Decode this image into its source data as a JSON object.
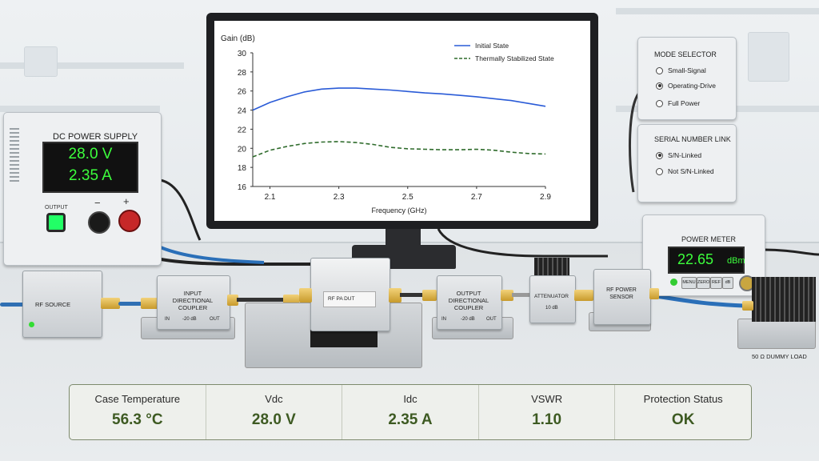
{
  "chart": {
    "ylabel": "Gain (dB)",
    "xlabel": "Frequency (GHz)",
    "y_ticks": [
      "30",
      "28",
      "26",
      "24",
      "22",
      "20",
      "18",
      "16"
    ],
    "x_ticks": [
      "2.1",
      "2.3",
      "2.5",
      "2.7",
      "2.9"
    ],
    "legend": [
      "Initial State",
      "Thermally Stabilized State"
    ]
  },
  "chart_data": {
    "type": "line",
    "xlabel": "Frequency (GHz)",
    "ylabel": "Gain (dB)",
    "xlim": [
      2.05,
      2.9
    ],
    "ylim": [
      16,
      30
    ],
    "series": [
      {
        "name": "Initial State",
        "color": "#2a5bd7",
        "style": "solid",
        "x": [
          2.05,
          2.1,
          2.15,
          2.2,
          2.25,
          2.3,
          2.35,
          2.4,
          2.45,
          2.5,
          2.55,
          2.6,
          2.65,
          2.7,
          2.75,
          2.8,
          2.85,
          2.9
        ],
        "y": [
          24.0,
          24.8,
          25.4,
          25.9,
          26.2,
          26.3,
          26.3,
          26.2,
          26.1,
          25.95,
          25.8,
          25.7,
          25.55,
          25.4,
          25.2,
          25.0,
          24.7,
          24.4
        ]
      },
      {
        "name": "Thermally Stabilized State",
        "color": "#2e6b2b",
        "style": "dashed",
        "x": [
          2.05,
          2.1,
          2.15,
          2.2,
          2.25,
          2.3,
          2.35,
          2.4,
          2.45,
          2.5,
          2.55,
          2.6,
          2.65,
          2.7,
          2.75,
          2.8,
          2.85,
          2.9
        ],
        "y": [
          19.1,
          19.8,
          20.2,
          20.5,
          20.65,
          20.7,
          20.6,
          20.4,
          20.1,
          19.95,
          19.9,
          19.85,
          19.85,
          19.9,
          19.8,
          19.6,
          19.45,
          19.4
        ]
      }
    ],
    "grid": false,
    "legend_position": "top-right"
  },
  "psu": {
    "title": "DC POWER SUPPLY",
    "voltage": "28.0 V",
    "current": "2.35 A",
    "output_label": "OUTPUT",
    "minus": "−",
    "plus": "+"
  },
  "mode_selector": {
    "title": "MODE SELECTOR",
    "options": [
      "Small-Signal",
      "Operating-Drive",
      "Full Power"
    ],
    "selected": "Operating-Drive"
  },
  "serial_link": {
    "title": "SERIAL NUMBER LINK",
    "options": [
      "S/N-Linked",
      "Not S/N-Linked"
    ],
    "selected": "S/N-Linked"
  },
  "power_meter": {
    "title": "POWER METER",
    "value": "22.65",
    "unit": "dBm",
    "buttons": [
      "MENU",
      "ZERO",
      "REF",
      "dB"
    ]
  },
  "rf_chain": {
    "source": "RF SOURCE",
    "input_coupler": "INPUT\nDIRECTIONAL\nCOUPLER",
    "input_coupler_in": "IN",
    "input_coupler_out": "OUT",
    "input_coupler_value": "-20 dB",
    "dut": "RF PA DUT",
    "output_coupler": "OUTPUT\nDIRECTIONAL\nCOUPLER",
    "output_coupler_in": "IN",
    "output_coupler_out": "OUT",
    "output_coupler_value": "-20 dB",
    "attenuator": "ATTENUATOR",
    "attenuator_value": "10 dB",
    "sensor": "RF POWER\nSENSOR",
    "load": "50 Ω DUMMY LOAD"
  },
  "status_bar": [
    {
      "label": "Case Temperature",
      "value": "56.3 °C"
    },
    {
      "label": "Vdc",
      "value": "28.0 V"
    },
    {
      "label": "Idc",
      "value": "2.35 A"
    },
    {
      "label": "VSWR",
      "value": "1.10"
    },
    {
      "label": "Protection Status",
      "value": "OK"
    }
  ]
}
